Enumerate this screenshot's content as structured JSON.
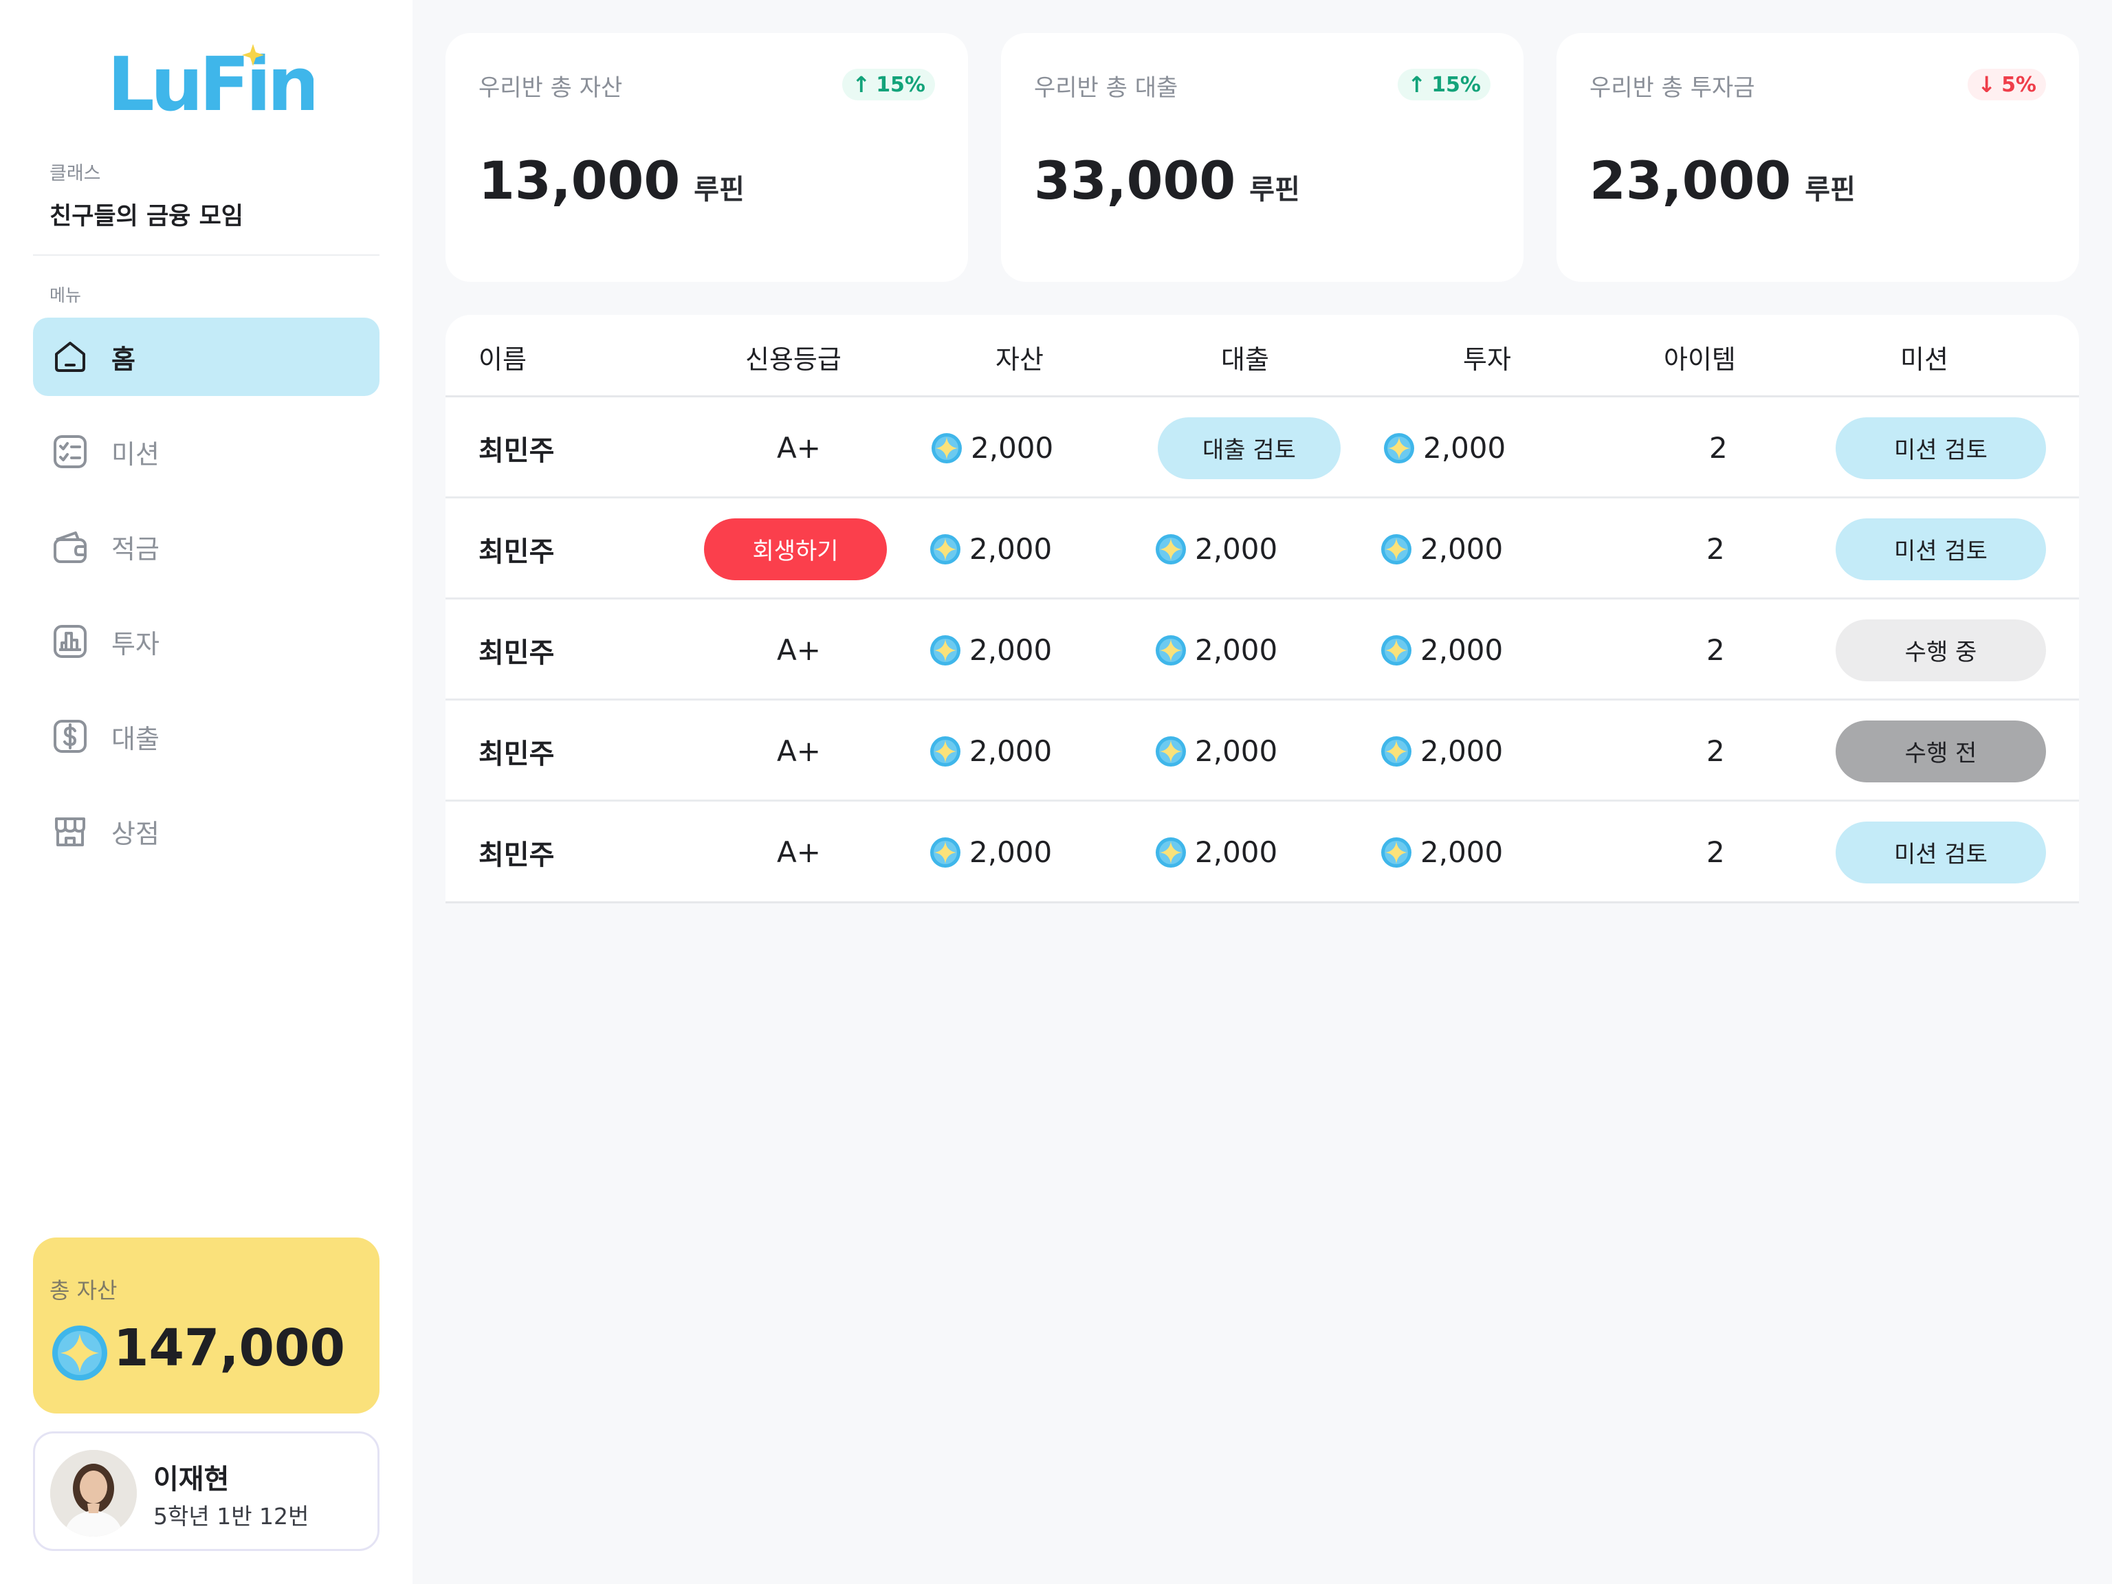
{
  "app": {
    "logo_text": "LuFin"
  },
  "sidebar": {
    "class_label": "클래스",
    "class_name": "친구들의 금융 모임",
    "menu_label": "메뉴",
    "items": [
      {
        "label": "홈",
        "icon": "home-icon",
        "active": true
      },
      {
        "label": "미션",
        "icon": "checklist-icon",
        "active": false
      },
      {
        "label": "적금",
        "icon": "wallet-icon",
        "active": false
      },
      {
        "label": "투자",
        "icon": "chart-icon",
        "active": false
      },
      {
        "label": "대출",
        "icon": "dollar-icon",
        "active": false
      },
      {
        "label": "상점",
        "icon": "store-icon",
        "active": false
      }
    ],
    "total_asset": {
      "label": "총 자산",
      "value": "147,000"
    },
    "profile": {
      "name": "이재현",
      "sub": "5학년 1반 12번"
    }
  },
  "stats": [
    {
      "label": "우리반 총 자산",
      "badge": "15%",
      "trend": "up",
      "value": "13,000",
      "unit": "루핀"
    },
    {
      "label": "우리반 총 대출",
      "badge": "15%",
      "trend": "up",
      "value": "33,000",
      "unit": "루핀"
    },
    {
      "label": "우리반 총 투자금",
      "badge": "5%",
      "trend": "down",
      "value": "23,000",
      "unit": "루핀"
    }
  ],
  "table": {
    "headers": [
      "이름",
      "신용등급",
      "자산",
      "대출",
      "투자",
      "아이템",
      "미션"
    ],
    "rows": [
      {
        "name": "최민주",
        "credit": "A+",
        "asset": "2,000",
        "loan": "대출 검토",
        "invest": "2,000",
        "item": "2",
        "mission": "미션 검토"
      },
      {
        "name": "최민주",
        "credit": "회생하기",
        "asset": "2,000",
        "loan": "2,000",
        "invest": "2,000",
        "item": "2",
        "mission": "미션 검토"
      },
      {
        "name": "최민주",
        "credit": "A+",
        "asset": "2,000",
        "loan": "2,000",
        "invest": "2,000",
        "item": "2",
        "mission": "수행 중"
      },
      {
        "name": "최민주",
        "credit": "A+",
        "asset": "2,000",
        "loan": "2,000",
        "invest": "2,000",
        "item": "2",
        "mission": "수행 전"
      },
      {
        "name": "최민주",
        "credit": "A+",
        "asset": "2,000",
        "loan": "2,000",
        "invest": "2,000",
        "item": "2",
        "mission": "미션 검토"
      }
    ]
  },
  "colors": {
    "accent": "#c4ebf8",
    "brand": "#3fb6ea",
    "danger": "#fb3f4c",
    "gold": "#fae17b",
    "up": "#13a37a",
    "down": "#ef3e4a"
  }
}
